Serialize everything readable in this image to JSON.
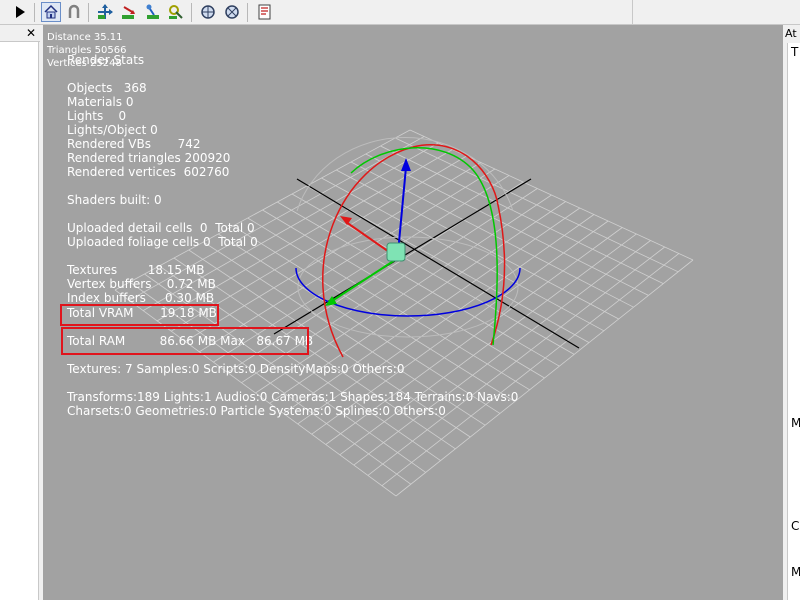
{
  "toolbar": {
    "buttons": [
      {
        "name": "play-button"
      },
      {
        "name": "home-view-button"
      },
      {
        "name": "magnet-button"
      },
      {
        "name": "move-tool-button"
      },
      {
        "name": "rotate-tool-button"
      },
      {
        "name": "scale-tool-button"
      },
      {
        "name": "pan-tool-button"
      },
      {
        "name": "world-space-button"
      },
      {
        "name": "local-space-button"
      },
      {
        "name": "stats-toggle-button"
      }
    ]
  },
  "left_panel": {
    "close_label": "✕"
  },
  "right_panel": {
    "tab_label": "At",
    "body_first_letter": "T",
    "letters": [
      "M",
      "C",
      "M"
    ]
  },
  "camera_info": {
    "distance": "Distance 35.11",
    "triangles": "Triangles 50566",
    "vertices": "Vertices 25248"
  },
  "render_stats": {
    "title": "Render Stats",
    "objects": "Objects   368",
    "materials": "Materials 0",
    "lights": "Lights    0",
    "lights_per_object": "Lights/Object 0",
    "rendered_vbs": "Rendered VBs       742",
    "rendered_triangles": "Rendered triangles 200920",
    "rendered_vertices": "Rendered vertices  602760",
    "shaders_built": "Shaders built: 0",
    "uploaded_detail_cells": "Uploaded detail cells  0  Total 0",
    "uploaded_foliage_cells": "Uploaded foliage cells 0  Total 0",
    "textures": "Textures        18.15 MB",
    "vertex_buffers": "Vertex buffers    0.72 MB",
    "index_buffers": "Index buffers     0.30 MB",
    "total_vram": "Total VRAM       19.18 MB",
    "total_ram": "Total RAM         86.66 MB Max   86.67 MB",
    "resources_line": "Textures: 7 Samples:0 Scripts:0 DensityMaps:0 Others:0",
    "transforms_line": "Transforms:189 Lights:1 Audios:0 Cameras:1 Shapes:184 Terrains:0 Navs:0",
    "charsets_line": "Charsets:0 Geometries:0 Particle Systems:0 Splines:0 Others:0"
  },
  "colors": {
    "viewport_bg": "#a2a2a2",
    "grid_line": "#d0d0d0",
    "highlight_box": "#e0141c",
    "axis_x": "#e01818",
    "axis_y": "#00c800",
    "axis_z": "#0000e0"
  }
}
